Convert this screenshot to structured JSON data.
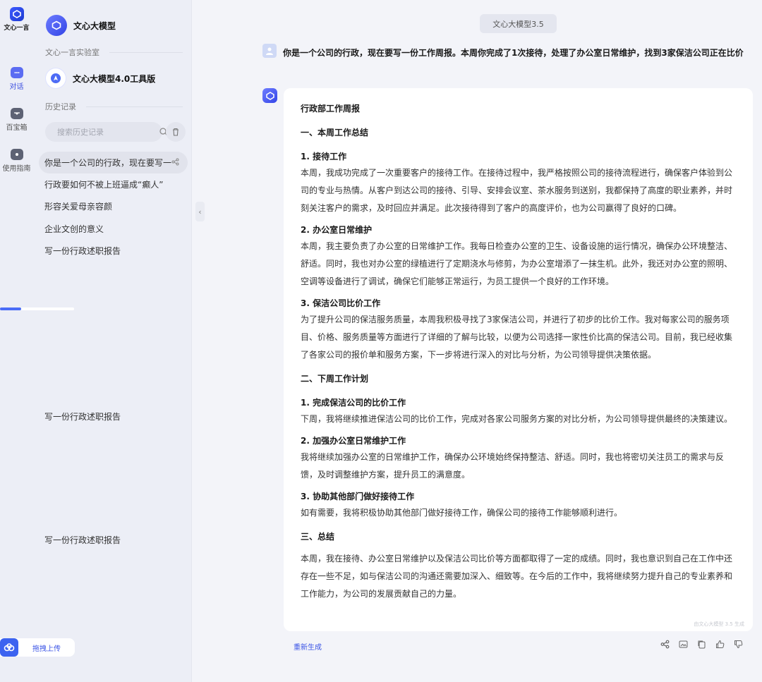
{
  "rail": {
    "logo_text": "文心一言",
    "items": [
      {
        "label": "对话",
        "icon": "chat-icon"
      },
      {
        "label": "百宝箱",
        "icon": "treasure-box-icon"
      },
      {
        "label": "使用指南",
        "icon": "guide-icon"
      }
    ]
  },
  "sidebar": {
    "brand_name": "文心大模型",
    "lab_label": "文心一言实验室",
    "tool_name": "文心大模型4.0工具版",
    "history_label": "历史记录",
    "search_placeholder": "搜索历史记录",
    "history": [
      "你是一个公司的行政，现在要写一",
      "行政要如何不被上班逼成“癫人”",
      "形容关爱母亲容颜",
      "企业文创的意义",
      "写一份行政述职报告",
      "写一份行政述职报告",
      "写一份行政述职报告"
    ],
    "upload_label": "拖拽上传"
  },
  "main": {
    "model_tag": "文心大模型3.5",
    "user_message": "你是一个公司的行政，现在要写一份工作周报。本周你完成了1次接待，处理了办公室日常维护，找到3家保洁公司正在比价",
    "answer": {
      "title": "行政部工作周报",
      "s1": "一、本周工作总结",
      "s1_1": "1. 接待工作",
      "s1_1p": "本周，我成功完成了一次重要客户的接待工作。在接待过程中，我严格按照公司的接待流程进行，确保客户体验到公司的专业与热情。从客户到达公司的接待、引导、安排会议室、茶水服务到送别，我都保持了高度的职业素养，并时刻关注客户的需求，及时回应并满足。此次接待得到了客户的高度评价，也为公司赢得了良好的口碑。",
      "s1_2": "2. 办公室日常维护",
      "s1_2p": "本周，我主要负责了办公室的日常维护工作。我每日检查办公室的卫生、设备设施的运行情况，确保办公环境整洁、舒适。同时，我也对办公室的绿植进行了定期浇水与修剪，为办公室增添了一抹生机。此外，我还对办公室的照明、空调等设备进行了调试，确保它们能够正常运行，为员工提供一个良好的工作环境。",
      "s1_3": "3. 保洁公司比价工作",
      "s1_3p": "为了提升公司的保洁服务质量，本周我积极寻找了3家保洁公司，并进行了初步的比价工作。我对每家公司的服务项目、价格、服务质量等方面进行了详细的了解与比较，以便为公司选择一家性价比高的保洁公司。目前，我已经收集了各家公司的报价单和服务方案，下一步将进行深入的对比与分析，为公司领导提供决策依据。",
      "s2": "二、下周工作计划",
      "s2_1": "1. 完成保洁公司的比价工作",
      "s2_1p": "下周，我将继续推进保洁公司的比价工作，完成对各家公司服务方案的对比分析，为公司领导提供最终的决策建议。",
      "s2_2": "2. 加强办公室日常维护工作",
      "s2_2p": "我将继续加强办公室的日常维护工作，确保办公环境始终保持整洁、舒适。同时，我也将密切关注员工的需求与反馈，及时调整维护方案，提升员工的满意度。",
      "s2_3": "3. 协助其他部门做好接待工作",
      "s2_3p": "如有需要，我将积极协助其他部门做好接待工作，确保公司的接待工作能够顺利进行。",
      "s3": "三、总结",
      "s3p": "本周，我在接待、办公室日常维护以及保洁公司比价等方面都取得了一定的成绩。同时，我也意识到自己在工作中还存在一些不足，如与保洁公司的沟通还需要加深入、细致等。在今后的工作中，我将继续努力提升自己的专业素养和工作能力，为公司的发展贡献自己的力量。",
      "watermark": "由文心大模型 3.5 生成"
    },
    "regenerate_label": "重新生成",
    "actions": [
      "share-icon",
      "image-icon",
      "copy-icon",
      "thumbs-up-icon",
      "thumbs-down-icon"
    ]
  }
}
